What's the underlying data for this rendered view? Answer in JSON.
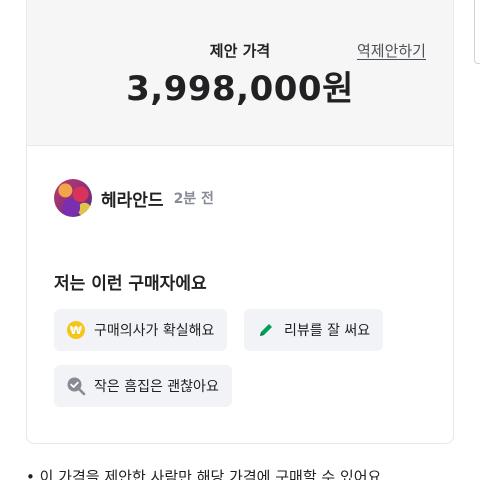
{
  "price_panel": {
    "label": "제안 가격",
    "counter_offer_label": "역제안하기",
    "value": "3,998,000원"
  },
  "buyer": {
    "name": "헤라안드",
    "time": "2분 전"
  },
  "traits": {
    "title": "저는 이런 구매자에요",
    "badges": [
      {
        "label": "구매의사가 확실해요",
        "icon": "won-coin-icon"
      },
      {
        "label": "리뷰를 잘 써요",
        "icon": "pencil-icon"
      },
      {
        "label": "작은 흠집은 괜찮아요",
        "icon": "magnifier-check-icon"
      }
    ]
  },
  "footer": {
    "note": "• 이 가격을 제안한 사람만 해당 가격에 구매할 수 있어요"
  },
  "colors": {
    "accent_green": "#00a05b",
    "coin_yellow": "#f5c519",
    "badge_bg": "#f2f3f6",
    "panel_bg": "#f6f6f7"
  }
}
